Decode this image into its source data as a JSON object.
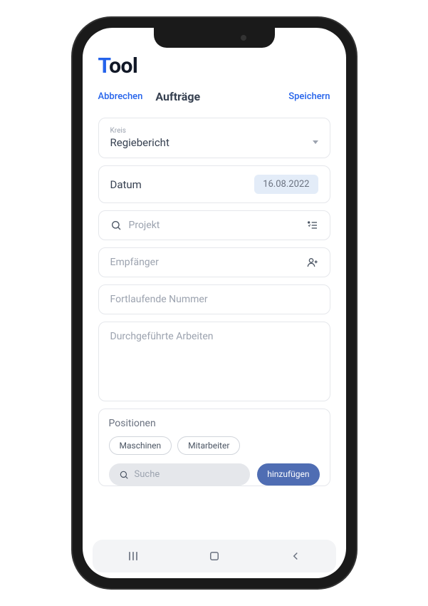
{
  "logo": {
    "accent": "T",
    "rest": "ool"
  },
  "header": {
    "cancel": "Abbrechen",
    "title": "Aufträge",
    "save": "Speichern"
  },
  "form": {
    "kreis": {
      "label": "Kreis",
      "value": "Regiebericht"
    },
    "datum": {
      "label": "Datum",
      "value": "16.08.2022"
    },
    "projekt": {
      "placeholder": "Projekt"
    },
    "empfaenger": {
      "placeholder": "Empfänger"
    },
    "fortlaufende": {
      "placeholder": "Fortlaufende Nummer"
    },
    "arbeiten": {
      "placeholder": "Durchgeführte Arbeiten"
    }
  },
  "positions": {
    "title": "Positionen",
    "chips": [
      "Maschinen",
      "Mitarbeiter"
    ],
    "search_placeholder": "Suche",
    "add_label": "hinzufügen"
  }
}
